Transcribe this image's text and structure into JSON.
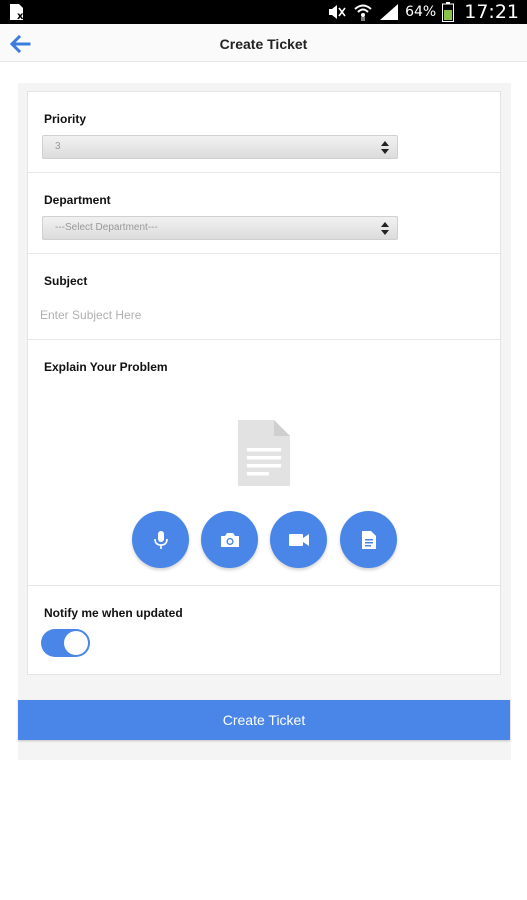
{
  "status_bar": {
    "battery_percent": "64%",
    "time": "17:21",
    "icons": [
      "app-x-icon",
      "mute-icon",
      "wifi-icon",
      "signal-icon",
      "battery-icon"
    ]
  },
  "header": {
    "title": "Create Ticket",
    "back_icon": "arrow-left-icon"
  },
  "form": {
    "priority": {
      "label": "Priority",
      "value": "3"
    },
    "department": {
      "label": "Department",
      "value": "---Select Department---"
    },
    "subject": {
      "label": "Subject",
      "placeholder": "Enter Subject Here"
    },
    "problem": {
      "label": "Explain Your Problem",
      "placeholder_icon": "document-icon",
      "attach_buttons": [
        "microphone-icon",
        "camera-icon",
        "video-icon",
        "file-icon"
      ]
    },
    "notify": {
      "label": "Notify me when updated",
      "enabled": true
    }
  },
  "submit": {
    "label": "Create Ticket"
  },
  "colors": {
    "accent": "#4a86e8",
    "panel": "#f4f4f4"
  }
}
